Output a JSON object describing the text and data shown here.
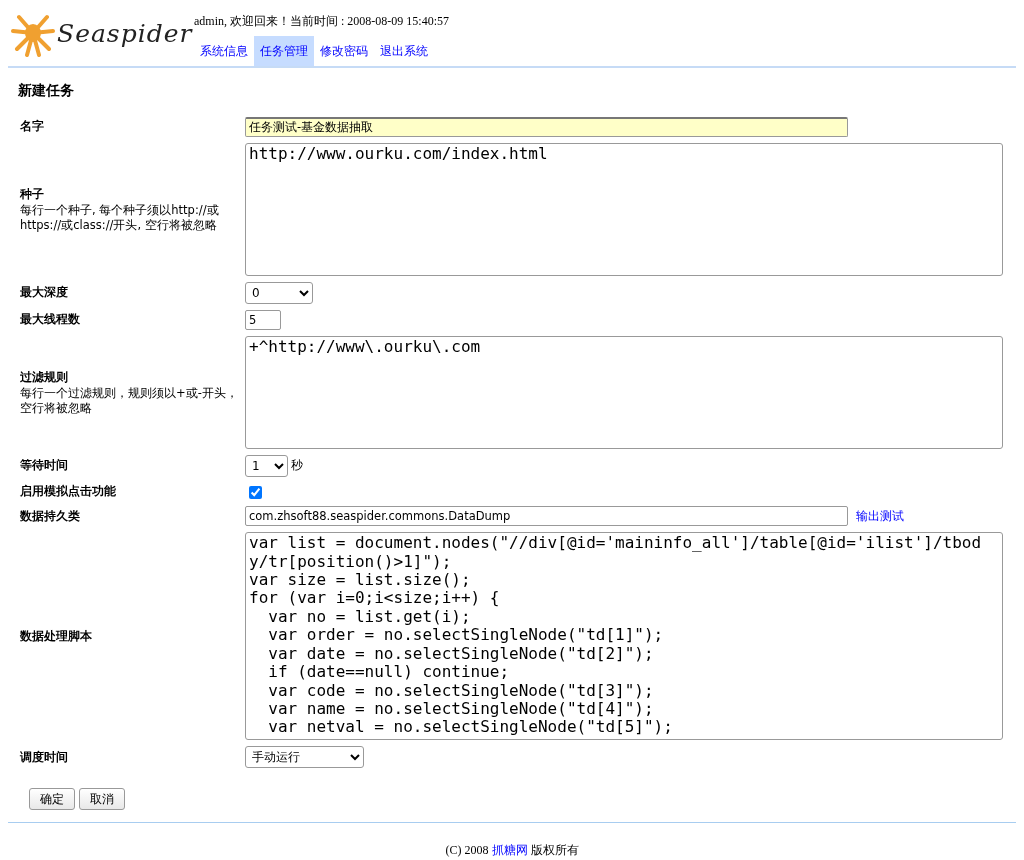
{
  "header": {
    "logo_text": "Seaspider",
    "welcome": "admin, 欢迎回来！当前时间 : 2008-08-09 15:40:57",
    "nav": [
      {
        "label": "系统信息",
        "selected": false
      },
      {
        "label": "任务管理",
        "selected": true
      },
      {
        "label": "修改密码",
        "selected": false
      },
      {
        "label": "退出系统",
        "selected": false
      }
    ]
  },
  "page_title": "新建任务",
  "fields": [
    {
      "kind": "text",
      "label": "名字",
      "value": "任务测试-基金数据抽取",
      "focused": true
    },
    {
      "kind": "textarea",
      "label": "种子",
      "hint": "每行一个种子, 每个种子须以http://或https://或class://开头, 空行将被忽略",
      "value": "http://www.ourku.com/index.html"
    },
    {
      "kind": "select",
      "label": "最大深度",
      "value": "0"
    },
    {
      "kind": "text",
      "label": "最大线程数",
      "value": "5",
      "focused": false
    },
    {
      "kind": "textarea",
      "label": "过滤规则",
      "hint": "每行一个过滤规则，规则须以+或-开头，空行将被忽略",
      "value": "+^http://www\\.ourku\\.com"
    },
    {
      "kind": "select",
      "label": "等待时间",
      "value": "1",
      "suffix": "秒"
    },
    {
      "kind": "checkbox",
      "label": "启用模拟点击功能",
      "checked": true
    },
    {
      "kind": "text",
      "label": "数据持久类",
      "value": "com.zhsoft88.seaspider.commons.DataDump",
      "focused": false,
      "link": "输出测试"
    },
    {
      "kind": "textarea",
      "label": "数据处理脚本",
      "value": "var list = document.nodes(\"//div[@id='maininfo_all']/table[@id='ilist']/tbody/tr[position()>1]\");\nvar size = list.size();\nfor (var i=0;i<size;i++) {\n  var no = list.get(i);\n  var order = no.selectSingleNode(\"td[1]\");\n  var date = no.selectSingleNode(\"td[2]\");\n  if (date==null) continue;\n  var code = no.selectSingleNode(\"td[3]\");\n  var name = no.selectSingleNode(\"td[4]\");\n  var netval = no.selectSingleNode(\"td[5]\");"
    },
    {
      "kind": "select",
      "label": "调度时间",
      "value": "手动运行"
    }
  ],
  "buttons": [
    "确定",
    "取消"
  ],
  "footer": {
    "prefix": "(C) 2008",
    "link": "抓糖网",
    "suffix": "版权所有"
  }
}
